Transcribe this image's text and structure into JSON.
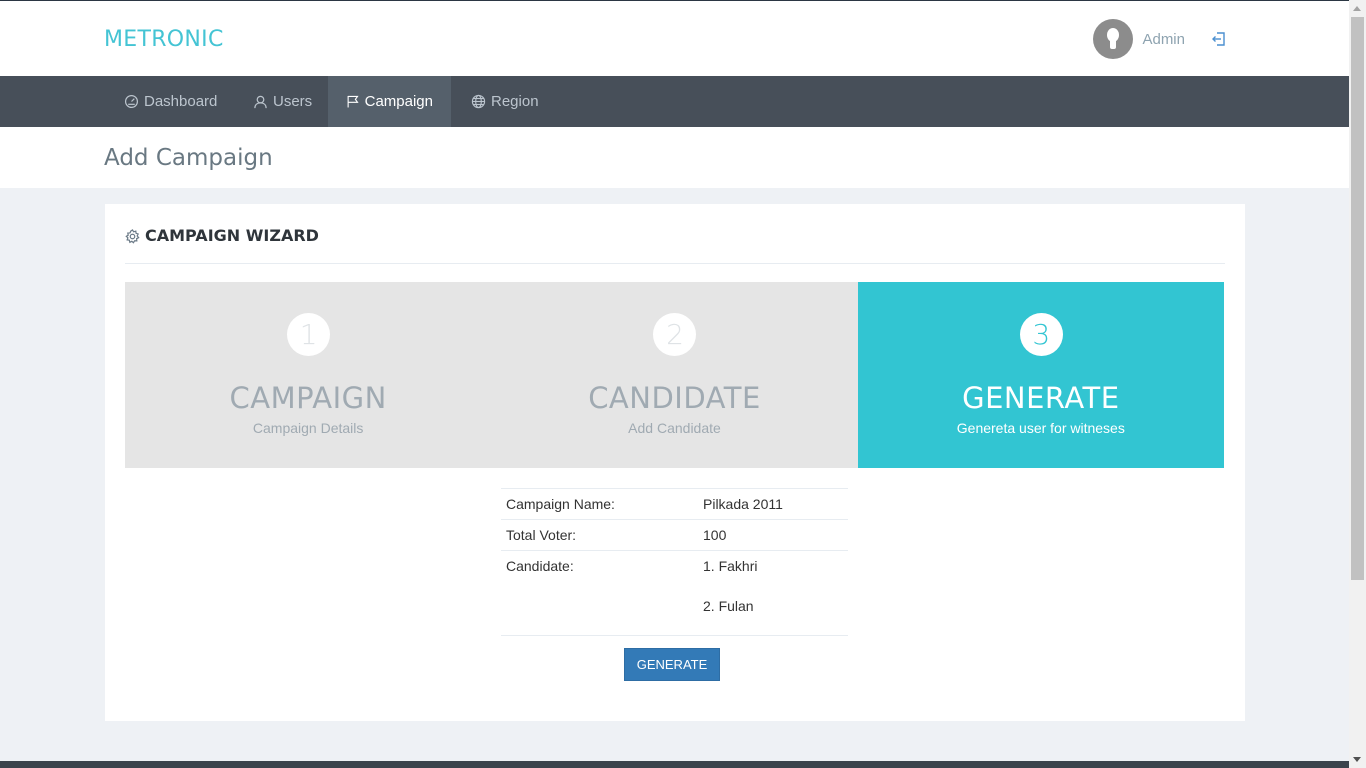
{
  "header": {
    "logo": "METRONIC",
    "user_name": "Admin"
  },
  "nav": {
    "items": [
      {
        "label": "Dashboard",
        "icon": "dashboard-gauge-icon"
      },
      {
        "label": "Users",
        "icon": "users-icon"
      },
      {
        "label": "Campaign",
        "icon": "flag-icon",
        "active": true
      },
      {
        "label": "Region",
        "icon": "globe-icon"
      }
    ]
  },
  "page": {
    "title": "Add Campaign"
  },
  "wizard": {
    "caption": "CAMPAIGN WIZARD",
    "steps": [
      {
        "number": "1",
        "title": "CAMPAIGN",
        "description": "Campaign Details"
      },
      {
        "number": "2",
        "title": "CANDIDATE",
        "description": "Add Candidate"
      },
      {
        "number": "3",
        "title": "GENERATE",
        "description": "Genereta user for witneses",
        "active": true
      }
    ],
    "summary": {
      "campaign_name_label": "Campaign Name:",
      "campaign_name_value": "Pilkada 2011",
      "total_voter_label": "Total Voter:",
      "total_voter_value": "100",
      "candidate_label": "Candidate:",
      "candidates": [
        "1. Fakhri",
        "2. Fulan"
      ]
    },
    "generate_button": "GENERATE"
  },
  "colors": {
    "brand": "#44c4d4",
    "active_step": "#32c5d2",
    "nav_bg": "#474f59",
    "button": "#337ab7"
  }
}
